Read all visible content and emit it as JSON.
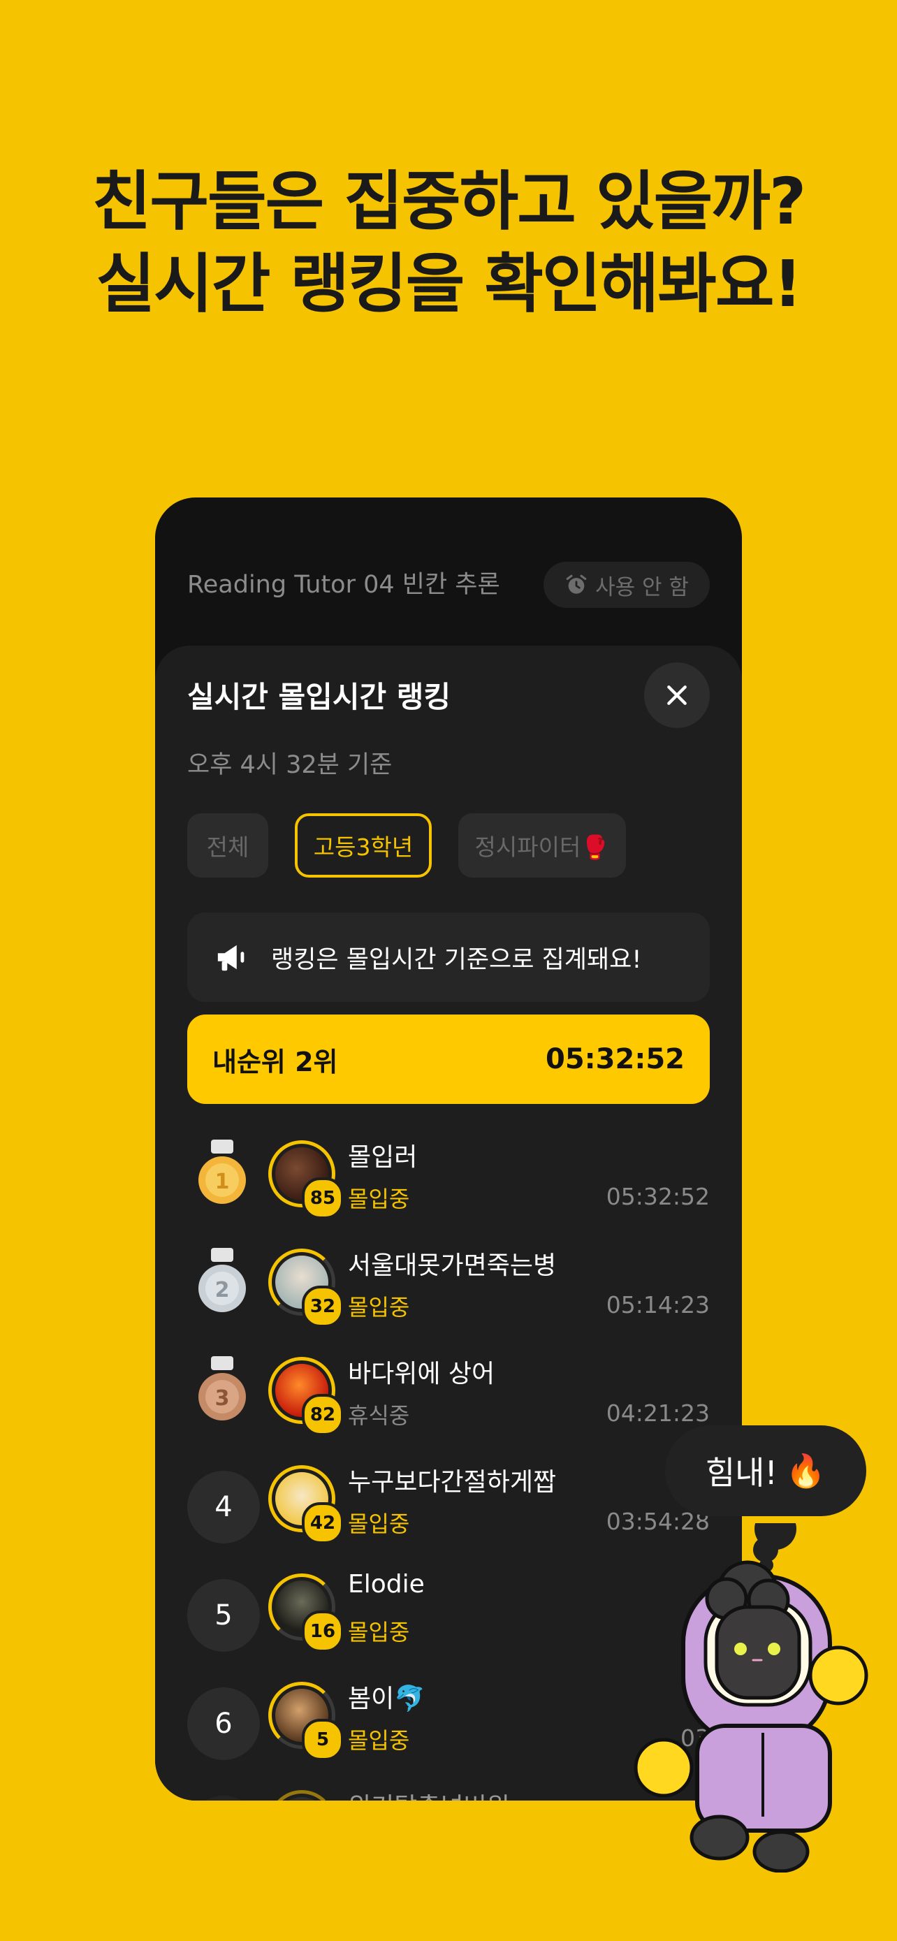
{
  "headline": {
    "line1": "친구들은 집중하고 있을까?",
    "line2": "실시간 랭킹을 확인해봐요!"
  },
  "topbar": {
    "title": "Reading Tutor 04 빈칸 추론",
    "pill_icon": "alarm-clock-icon",
    "pill_label": "사용 안 함"
  },
  "sheet": {
    "title": "실시간 몰입시간 랭킹",
    "close_icon": "close-icon",
    "updated": "오후 4시 32분 기준",
    "chips": [
      {
        "label": "전체",
        "active": false
      },
      {
        "label": "고등3학년",
        "active": true
      },
      {
        "label": "정시파이터🥊",
        "active": false
      }
    ],
    "notice_icon": "megaphone-icon",
    "notice": "랭킹은 몰입시간 기준으로 집계돼요!",
    "my_rank": {
      "label": "내순위 2위",
      "time": "05:32:52"
    }
  },
  "rankings": [
    {
      "rank": "1",
      "medal": "gold",
      "level": "85",
      "name": "몰입러",
      "status": "몰입중",
      "time": "05:32:52"
    },
    {
      "rank": "2",
      "medal": "silver",
      "level": "32",
      "name": "서울대못가면죽는병",
      "status": "몰입중",
      "time": "05:14:23"
    },
    {
      "rank": "3",
      "medal": "bronze",
      "level": "82",
      "name": "바다위에 상어",
      "status": "휴식중",
      "time": "04:21:23"
    },
    {
      "rank": "4",
      "level": "42",
      "name": "누구보다간절하게짭",
      "status": "몰입중",
      "time": "03:54:28"
    },
    {
      "rank": "5",
      "level": "16",
      "name": "Elodie",
      "status": "몰입중",
      "time": ""
    },
    {
      "rank": "6",
      "level": "5",
      "name": "봄이🐬",
      "status": "몰입중",
      "time": "03"
    },
    {
      "rank": "",
      "level": "",
      "name": "위기탈출넘버원",
      "status": "",
      "time": ""
    }
  ],
  "bubble": {
    "label": "힘내!",
    "emoji": "🔥"
  },
  "colors": {
    "accent": "#F5C300",
    "background": "#F5C300",
    "panel": "#1e1e1e"
  }
}
